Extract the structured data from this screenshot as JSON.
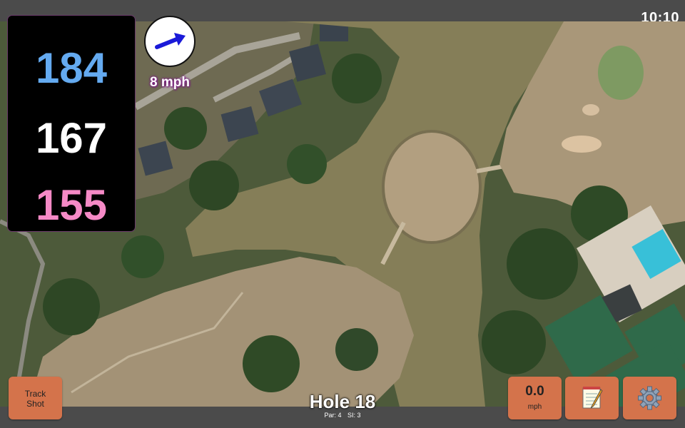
{
  "status": {
    "time": "10:10"
  },
  "distances": {
    "back": "184",
    "middle": "167",
    "front": "155"
  },
  "wind": {
    "speed_label": "8 mph",
    "direction_icon": "wind-arrow-icon"
  },
  "hole": {
    "title": "Hole 18",
    "par": "Par: 4",
    "si": "SI: 3"
  },
  "buttons": {
    "track_shot_line1": "Track",
    "track_shot_line2": "Shot",
    "speed_value": "0.0",
    "speed_unit": "mph",
    "notes_icon": "notepad-icon",
    "settings_icon": "gear-icon"
  },
  "colors": {
    "back_distance": "#64aaf0",
    "middle_distance": "#ffffff",
    "front_distance": "#f58ac6",
    "button_bg": "#d4734b",
    "wind_arrow": "#1a1ad8"
  }
}
